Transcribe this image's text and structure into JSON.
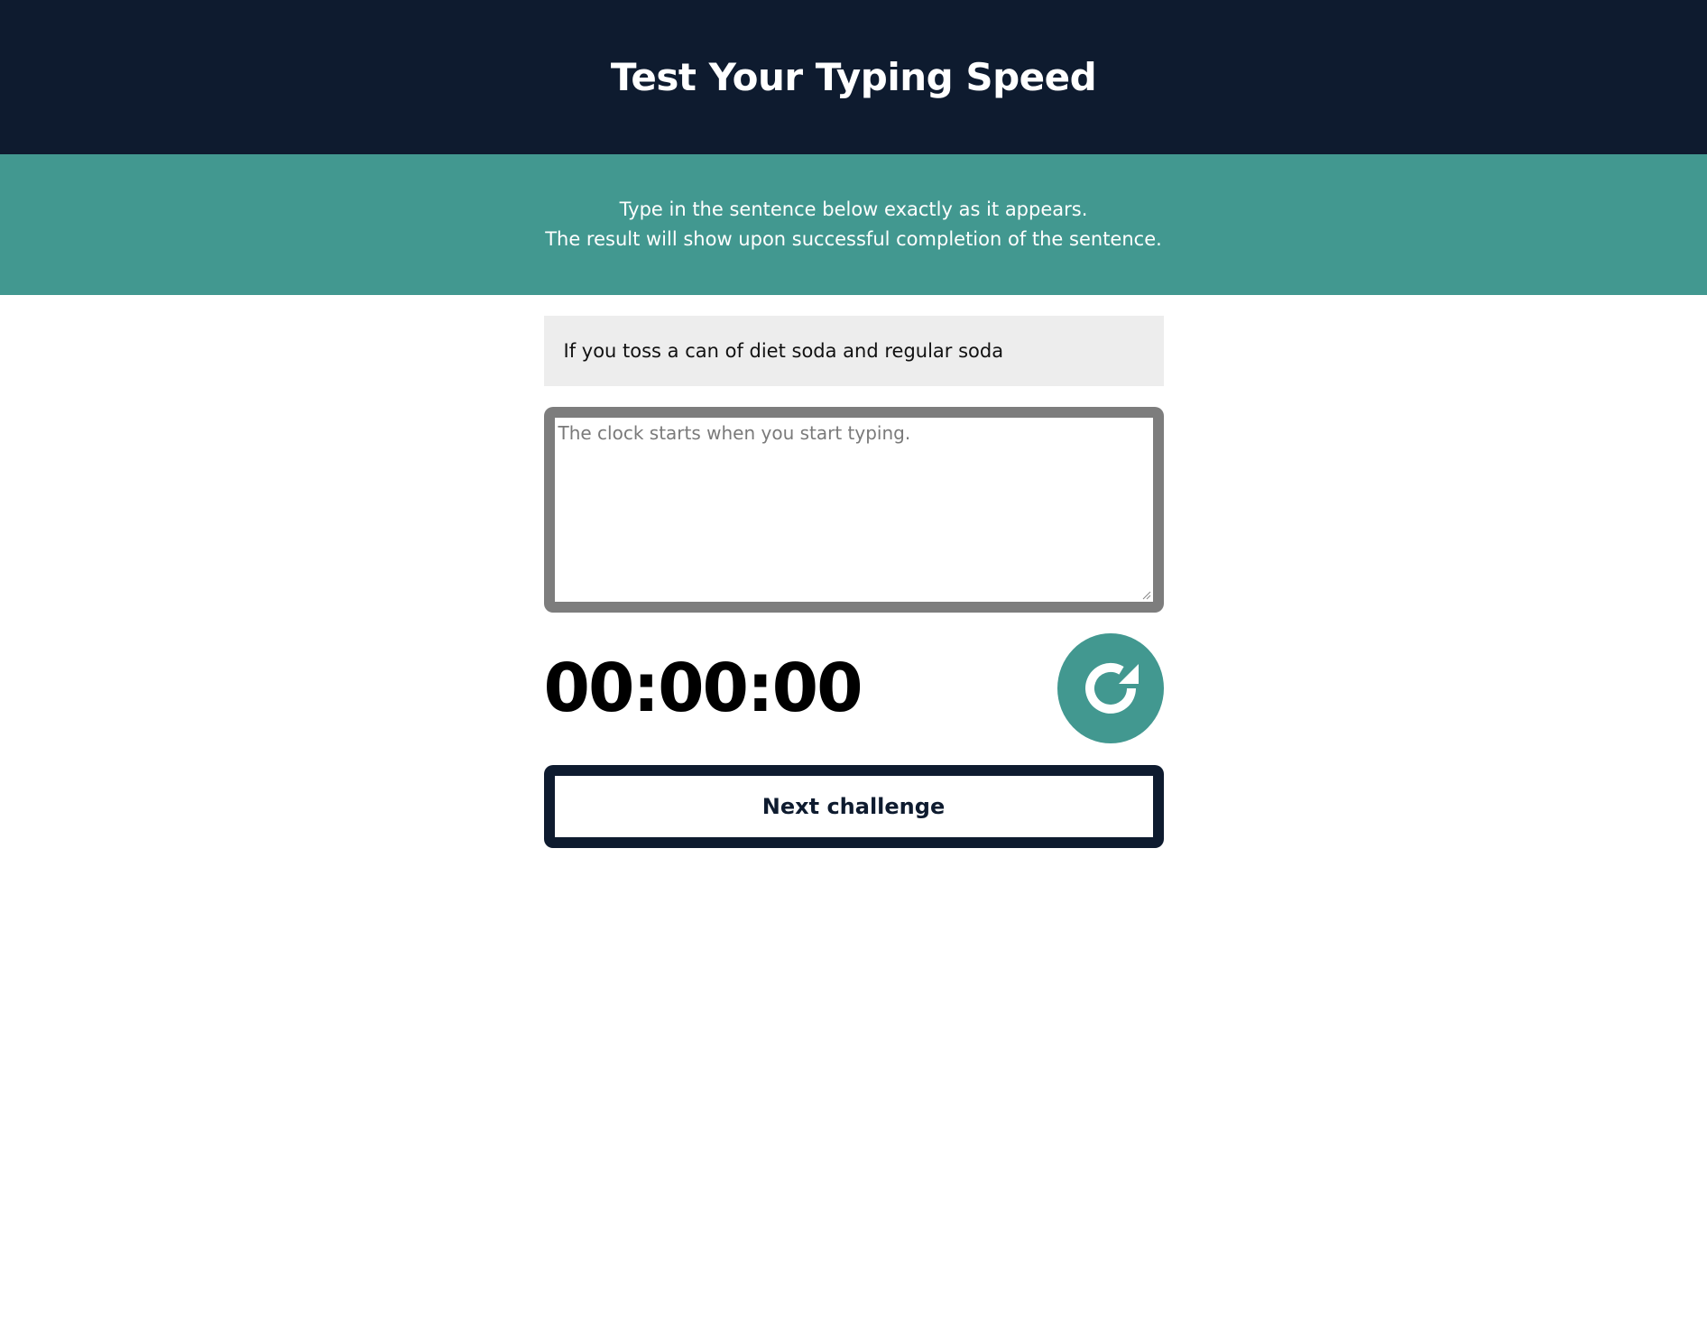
{
  "header": {
    "title": "Test Your Typing Speed"
  },
  "intro": {
    "line1": "Type in the sentence below exactly as it appears.",
    "line2": "The result will show upon successful completion of the sentence."
  },
  "challenge": {
    "sentence": "If you toss a can of diet soda and regular soda"
  },
  "typing_input": {
    "value": "",
    "placeholder": "The clock starts when you start typing."
  },
  "timer": {
    "value": "00:00:00"
  },
  "reset_button": {
    "icon": "refresh-icon"
  },
  "next_button": {
    "label": "Next challenge"
  },
  "colors": {
    "header_bg": "#0e1b2f",
    "accent": "#429890",
    "sentence_bg": "#ededed",
    "input_border": "#7d7d7d"
  }
}
